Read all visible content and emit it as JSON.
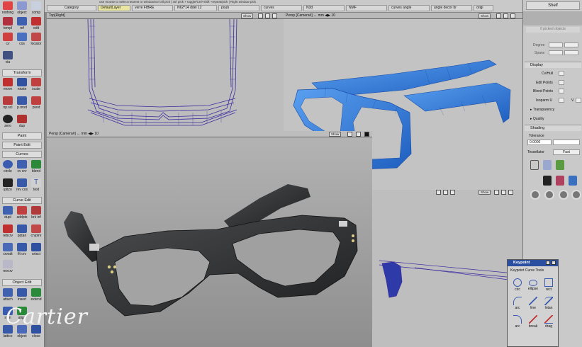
{
  "topbar": {
    "hint": "use mouse to select nearest or window/ctrl all pick | ctrl pick + toggle/Ctrl+shift +repeat/pick | Right window pick",
    "category_label": "Category",
    "layers": [
      "DefaultLayer",
      "verre FIBRE",
      "N62*14 ddel 12",
      "poub",
      "curves",
      "N3d",
      "NMF",
      "curves angle",
      "angle decor br",
      "origi"
    ]
  },
  "palette": {
    "sections": {
      "transform": "Transform",
      "paint": "Paint",
      "paint_edit": "Paint Edit",
      "curves": "Curves",
      "curve_edit": "Curve Edit",
      "object_edit": "Object Edit"
    },
    "tools_top": [
      "nothing",
      "object",
      "comp",
      "templ",
      "ref",
      "edit",
      "cv",
      "cos",
      "locator",
      "via"
    ],
    "tools_transform": [
      "move",
      "rotate",
      "scale",
      "np.scl",
      "p.mod",
      "pivot",
      "zero",
      "dup"
    ],
    "tools_curves": [
      "circle",
      "cv crv",
      "blend",
      "ipltzo",
      "rev cos",
      "text"
    ],
    "tools_curve_edit": [
      "dupl",
      "addpts",
      "brk inf",
      "rebcrv",
      "prjtan",
      "crvplnr",
      "crvsdt",
      "fit crv",
      "srtsct",
      "revcrv"
    ],
    "tools_object_edit": [
      "attach",
      "insert",
      "extend",
      "sym",
      "align",
      "lattice",
      "object",
      "close"
    ]
  },
  "viewports": {
    "top": {
      "title": "Top[Right]",
      "show": "Show"
    },
    "persp_top": {
      "title": "Persp [Camera#] ↔ mm  ◀▶ 10",
      "show": "Show"
    },
    "persp_main": {
      "title": "Persp [Camera#] ↔ mm  ◀▶ 10",
      "show": "Show"
    },
    "fourth": {
      "show": "Show"
    }
  },
  "shelf": {
    "title": "Shelf",
    "picked_label": "0 picked objects",
    "degree_label": "Degree",
    "spans_label": "Spans",
    "display_hdr": "Display",
    "display_items": [
      "Cv/Hull",
      "Edit Points",
      "Blend Points",
      "Isoparm U"
    ],
    "v_label": "V",
    "transparency": "Transparency",
    "quality": "Quality",
    "shading_hdr": "Shading",
    "tolerance_label": "Tolerance",
    "tolerance_value": "0.0000",
    "tessellator_label": "Tessellator",
    "tessellator_value": "Fast"
  },
  "keypoint": {
    "title": "Keypoint",
    "subtitle": "Keypoint Curve Tools",
    "tools": [
      "circ",
      "ellipse",
      "rect",
      "arc",
      "line",
      "lntan",
      "arc",
      "break",
      "drag"
    ]
  },
  "watermark": "Cartier",
  "colors": {
    "blue_model": "#2f7ad8",
    "wire": "#3a2aa0",
    "dark_model": "#2b2d2e",
    "accent_red": "#c0392b"
  }
}
